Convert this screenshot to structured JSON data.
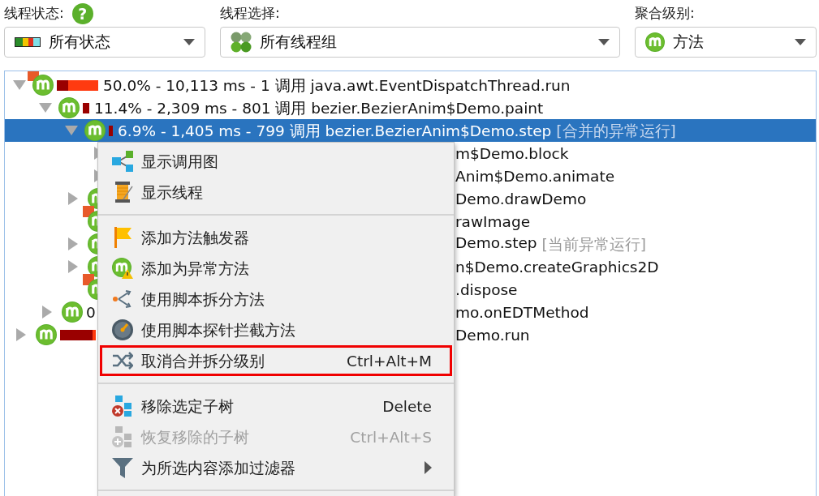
{
  "filters": [
    {
      "label": "线程状态:",
      "help": "?",
      "value": "所有状态"
    },
    {
      "label": "线程选择:",
      "value": "所有线程组"
    },
    {
      "label": "聚合级别:",
      "value": "方法"
    }
  ],
  "tree": [
    {
      "kind": "node",
      "expanded": true,
      "selected": false,
      "hotspot": true,
      "text": "50.0% - 10,113 ms - 1 调用 java.awt.EventDispatchThread.run",
      "children": [
        {
          "kind": "node",
          "expanded": true,
          "selected": false,
          "hotspot": false,
          "text": "11.4% - 2,309 ms - 801 调用 bezier.BezierAnim$Demo.paint",
          "children": [
            {
              "kind": "node",
              "expanded": true,
              "selected": true,
              "hotspot": false,
              "text": "6.9% - 1,405 ms - 799 调用 bezier.BezierAnim$Demo.step",
              "note": "[合并的异常运行]",
              "children": [
                {
                  "kind": "node",
                  "expanded": false,
                  "selected": false,
                  "hotspot": false,
                  "tail": "m$Demo.block"
                },
                {
                  "kind": "node",
                  "expanded": false,
                  "selected": false,
                  "hotspot": false,
                  "tail": "Anim$Demo.animate"
                }
              ]
            },
            {
              "kind": "node",
              "expanded": false,
              "selected": false,
              "hotspot": false,
              "tail": "Demo.drawDemo"
            },
            {
              "kind": "leaf",
              "selected": false,
              "hotspot": true,
              "tail": "rawImage"
            },
            {
              "kind": "node",
              "expanded": false,
              "selected": false,
              "hotspot": false,
              "tail": "Demo.step",
              "note": "[当前异常运行]"
            },
            {
              "kind": "node",
              "expanded": false,
              "selected": false,
              "hotspot": false,
              "tail": "n$Demo.createGraphics2D"
            },
            {
              "kind": "leaf",
              "selected": false,
              "hotspot": true,
              "tail": ".dispose"
            }
          ]
        },
        {
          "kind": "node",
          "expanded": false,
          "selected": false,
          "hotspot": false,
          "text": "0",
          "tail": "mo.onEDTMethod"
        }
      ]
    },
    {
      "kind": "node",
      "expanded": false,
      "selected": false,
      "hotspot": false,
      "tail": "Demo.run"
    }
  ],
  "context_menu": [
    {
      "kind": "item",
      "label": "显示调用图",
      "disabled": false,
      "highlighted": false
    },
    {
      "kind": "item",
      "label": "显示线程",
      "disabled": false,
      "highlighted": false
    },
    {
      "kind": "separator"
    },
    {
      "kind": "item",
      "label": "添加方法触发器",
      "disabled": false,
      "highlighted": false
    },
    {
      "kind": "item",
      "label": "添加为异常方法",
      "disabled": false,
      "highlighted": false
    },
    {
      "kind": "item",
      "label": "使用脚本拆分方法",
      "disabled": false,
      "highlighted": false
    },
    {
      "kind": "item",
      "label": "使用脚本探针拦截方法",
      "disabled": false,
      "highlighted": false
    },
    {
      "kind": "item",
      "label": "取消合并拆分级别",
      "shortcut": "Ctrl+Alt+M",
      "disabled": false,
      "highlighted": true
    },
    {
      "kind": "separator"
    },
    {
      "kind": "item",
      "label": "移除选定子树",
      "shortcut": "Delete",
      "disabled": false,
      "highlighted": false
    },
    {
      "kind": "item",
      "label": "恢复移除的子树",
      "shortcut": "Ctrl+Alt+S",
      "disabled": true,
      "highlighted": false
    },
    {
      "kind": "submenu",
      "label": "为所选内容添加过滤器",
      "disabled": false,
      "highlighted": false
    },
    {
      "kind": "separator"
    }
  ]
}
